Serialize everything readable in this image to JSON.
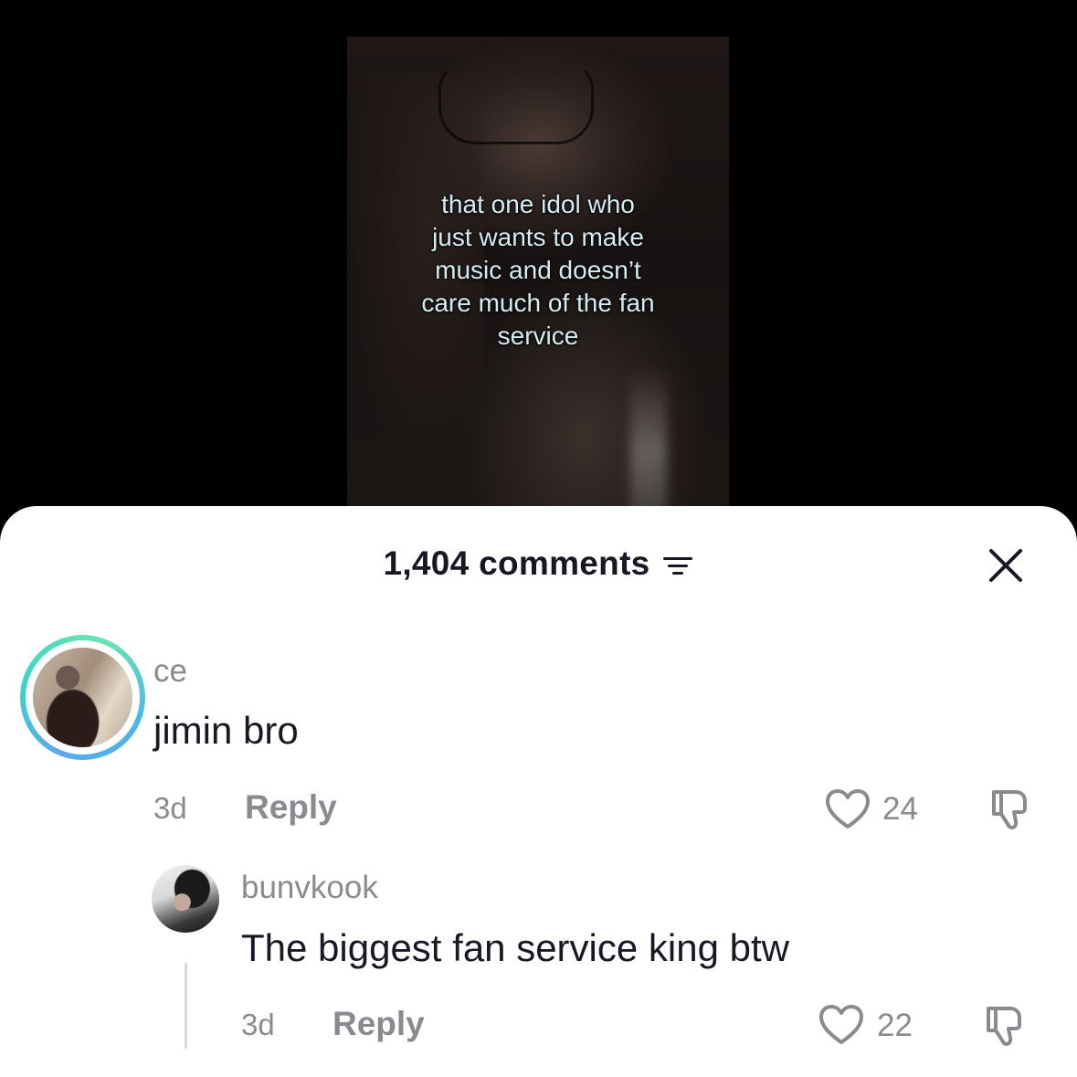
{
  "video": {
    "caption": "that one idol who\njust wants to make\nmusic and doesn’t\ncare much of the fan\nservice"
  },
  "comments_panel": {
    "count_label": "1,404 comments",
    "filter_icon": "filter-lines-icon",
    "close_icon": "close-x-icon"
  },
  "comments": [
    {
      "username": "ce",
      "text": "jimin bro",
      "time": "3d",
      "reply_label": "Reply",
      "likes": "24"
    },
    {
      "username": "bunvkook",
      "text": "The biggest fan service king btw",
      "time": "3d",
      "reply_label": "Reply",
      "likes": "22"
    }
  ],
  "colors": {
    "text_primary": "#161823",
    "text_secondary": "#8a8b91",
    "caption": "#d4ecf2",
    "story_ring_start": "#5aa7f0",
    "story_ring_end": "#6fe3b2"
  }
}
